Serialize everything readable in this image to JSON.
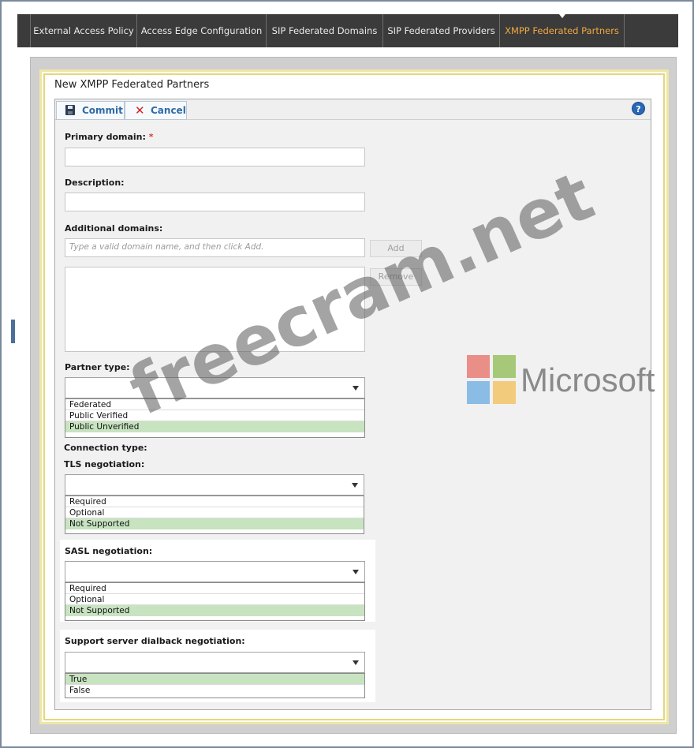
{
  "tabs": [
    {
      "label": "External Access Policy"
    },
    {
      "label": "Access Edge Configuration"
    },
    {
      "label": "SIP Federated Domains"
    },
    {
      "label": "SIP Federated Providers"
    },
    {
      "label": "XMPP Federated Partners",
      "active": true
    }
  ],
  "dialog": {
    "title": "New XMPP Federated Partners",
    "commit_label": "Commit",
    "cancel_label": "Cancel",
    "help_glyph": "?"
  },
  "form": {
    "primary_domain": {
      "label": "Primary domain:",
      "required_mark": "*",
      "value": ""
    },
    "description": {
      "label": "Description:",
      "value": ""
    },
    "additional_domains": {
      "label": "Additional domains:",
      "placeholder": "Type a valid domain name, and then click Add.",
      "add_label": "Add",
      "remove_label": "Remove",
      "items": []
    },
    "partner_type": {
      "label": "Partner type:",
      "value": "",
      "options": [
        {
          "label": "Federated",
          "highlighted": false
        },
        {
          "label": "Public Verified",
          "highlighted": false
        },
        {
          "label": "Public Unverified",
          "highlighted": true
        }
      ]
    },
    "connection_type_label": "Connection type:",
    "tls": {
      "label": "TLS negotiation:",
      "value": "",
      "options": [
        {
          "label": "Required",
          "highlighted": false
        },
        {
          "label": "Optional",
          "highlighted": false
        },
        {
          "label": "Not Supported",
          "highlighted": true
        }
      ]
    },
    "sasl": {
      "label": "SASL negotiation:",
      "value": "",
      "options": [
        {
          "label": "Required",
          "highlighted": false
        },
        {
          "label": "Optional",
          "highlighted": false
        },
        {
          "label": "Not Supported",
          "highlighted": true
        }
      ]
    },
    "dialback": {
      "label": "Support server dialback negotiation:",
      "value": "",
      "options": [
        {
          "label": "True",
          "highlighted": true
        },
        {
          "label": "False",
          "highlighted": false
        }
      ]
    }
  },
  "overlay": {
    "watermark": "freecram.net",
    "brand_text": "Microsoft",
    "logo_colors": [
      "#f25022",
      "#7fba00",
      "#00a4ef",
      "#ffb900"
    ]
  },
  "colors": {
    "tabbar": "#3b3b3b",
    "active_tab": "#f0a840",
    "highlight_option": "#c7e3c0",
    "required": "#d43b2a",
    "toolbar_text": "#2f6aa5"
  }
}
